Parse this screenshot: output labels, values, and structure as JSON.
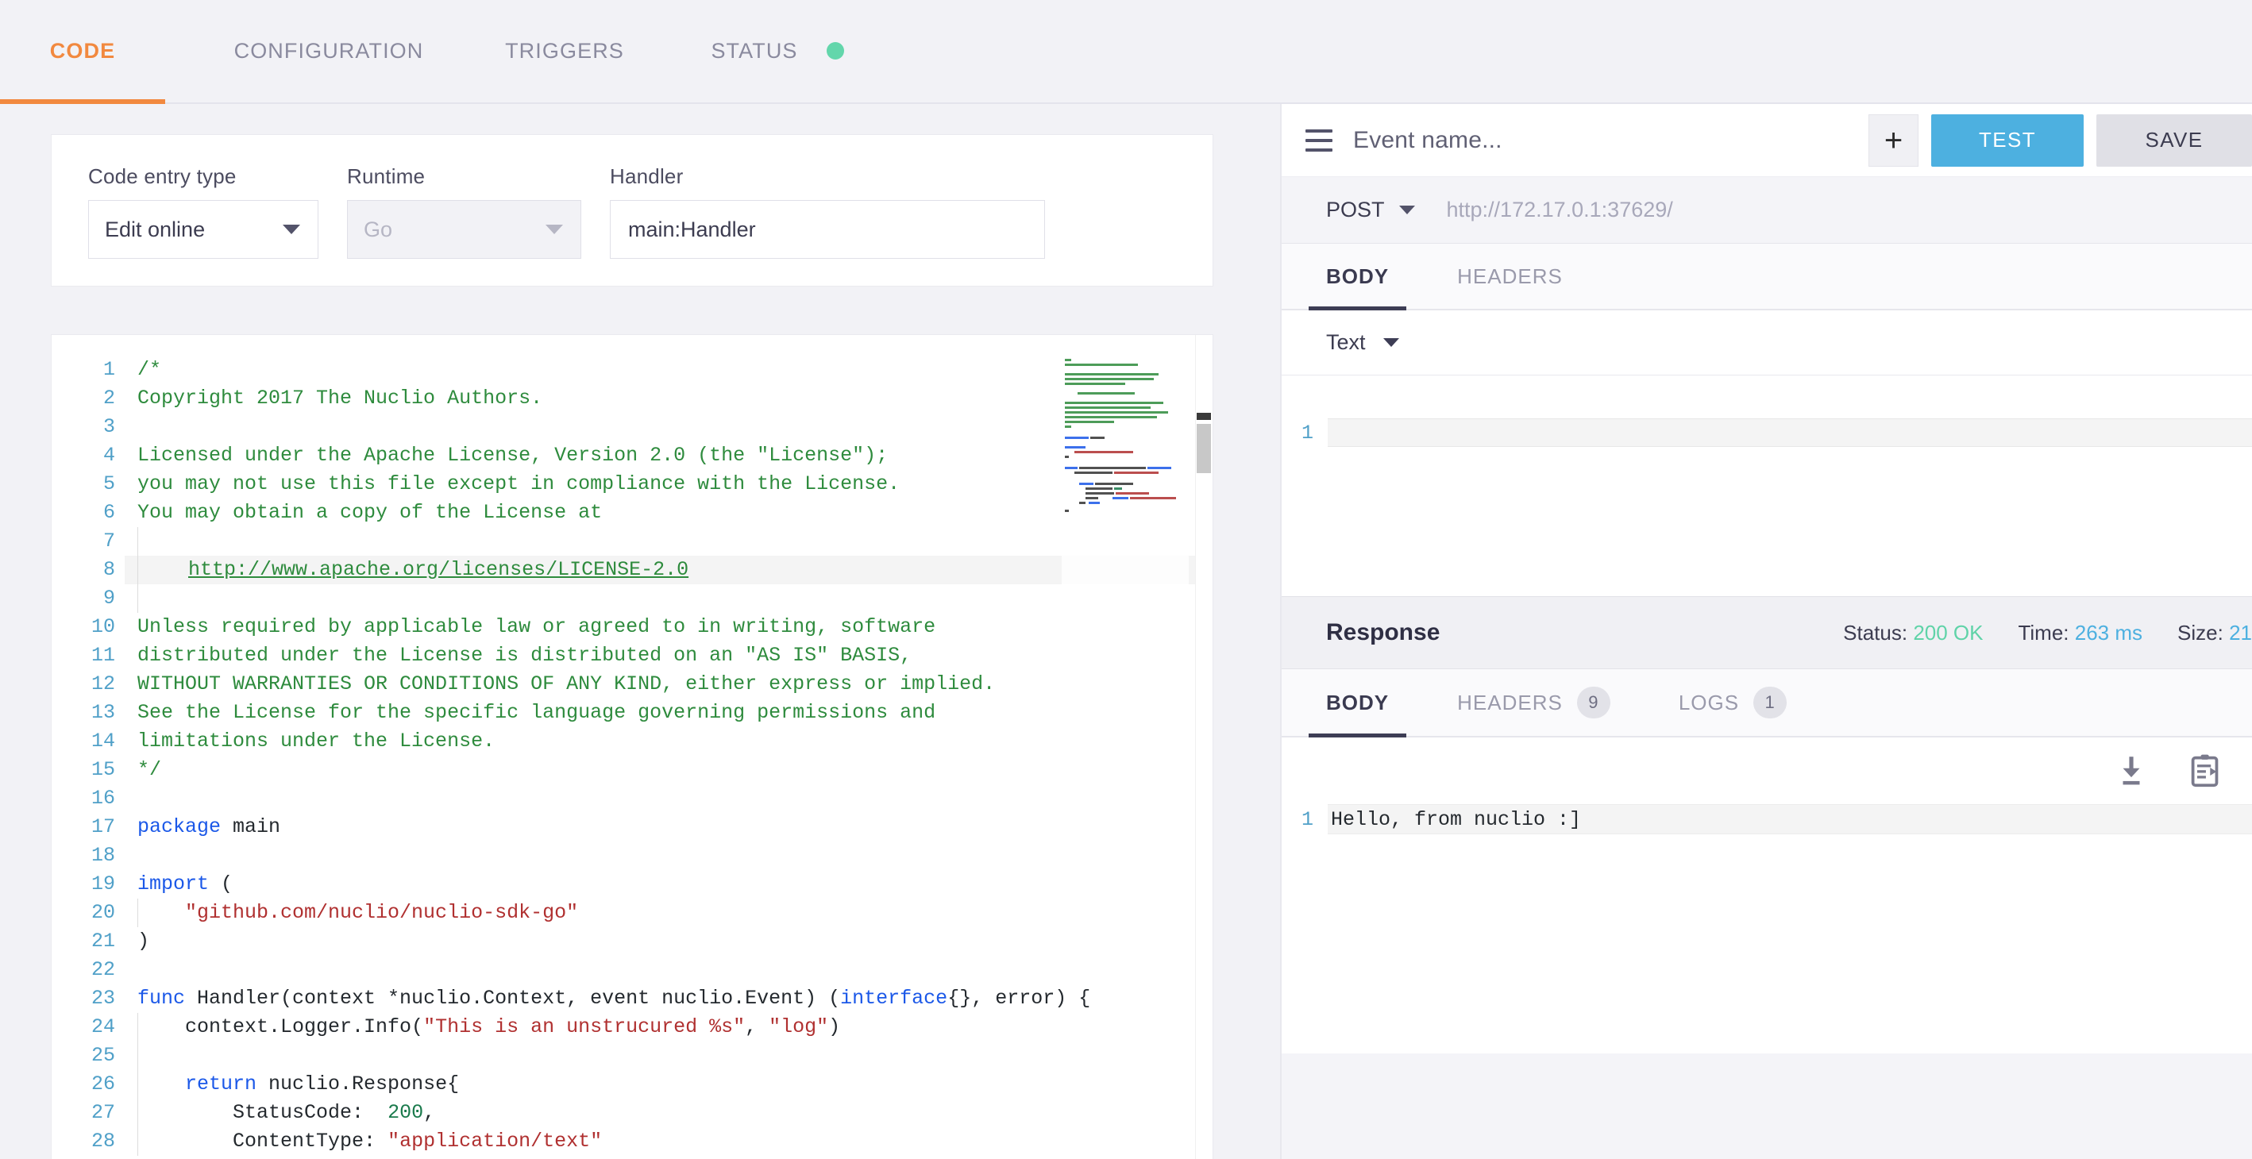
{
  "tabs": [
    {
      "label": "CODE",
      "active": true
    },
    {
      "label": "CONFIGURATION",
      "active": false
    },
    {
      "label": "TRIGGERS",
      "active": false
    },
    {
      "label": "STATUS",
      "active": false
    }
  ],
  "status_indicator": {
    "name": "status-dot",
    "color": "#63d6ab"
  },
  "form": {
    "code_entry_type": {
      "label": "Code entry type",
      "value": "Edit online"
    },
    "runtime": {
      "label": "Runtime",
      "value": "Go",
      "disabled": true
    },
    "handler": {
      "label": "Handler",
      "value": "main:Handler"
    }
  },
  "editor": {
    "language": "go",
    "line_numbers": [
      1,
      2,
      3,
      4,
      5,
      6,
      7,
      8,
      9,
      10,
      11,
      12,
      13,
      14,
      15,
      16,
      17,
      18,
      19,
      20,
      21,
      22,
      23,
      24,
      25,
      26,
      27,
      28
    ],
    "lines": [
      "/*",
      "Copyright 2017 The Nuclio Authors.",
      "",
      "Licensed under the Apache License, Version 2.0 (the \"License\");",
      "you may not use this file except in compliance with the License.",
      "You may obtain a copy of the License at",
      "",
      "    http://www.apache.org/licenses/LICENSE-2.0",
      "",
      "Unless required by applicable law or agreed to in writing, software",
      "distributed under the License is distributed on an \"AS IS\" BASIS,",
      "WITHOUT WARRANTIES OR CONDITIONS OF ANY KIND, either express or implied.",
      "See the License for the specific language governing permissions and",
      "limitations under the License.",
      "*/",
      "",
      "package main",
      "",
      "import (",
      "    \"github.com/nuclio/nuclio-sdk-go\"",
      ")",
      "",
      "func Handler(context *nuclio.Context, event nuclio.Event) (interface{}, error) {",
      "    context.Logger.Info(\"This is an unstrucured %s\", \"log\")",
      "",
      "    return nuclio.Response{",
      "        StatusCode:  200,",
      "        ContentType: \"application/text\""
    ],
    "highlighted_line": 8,
    "link_line_text": "http://www.apache.org/licenses/LICENSE-2.0"
  },
  "request": {
    "event_name_placeholder": "Event name...",
    "menu_icon": "hamburger-icon",
    "add_label": "+",
    "test_label": "TEST",
    "save_label": "SAVE",
    "method": "POST",
    "url": "http://172.17.0.1:37629/",
    "tabs": [
      {
        "label": "BODY",
        "active": true
      },
      {
        "label": "HEADERS",
        "active": false
      }
    ],
    "format": "Text",
    "body_line_number": "1",
    "body_value": ""
  },
  "response": {
    "title": "Response",
    "status_label": "Status:",
    "status_value": "200 OK",
    "time_label": "Time:",
    "time_value": "263 ms",
    "size_label": "Size:",
    "size_value": "21",
    "tabs": [
      {
        "label": "BODY",
        "active": true,
        "badge": ""
      },
      {
        "label": "HEADERS",
        "active": false,
        "badge": "9"
      },
      {
        "label": "LOGS",
        "active": false,
        "badge": "1"
      }
    ],
    "download_icon": "download-icon",
    "copy_icon": "copy-to-clipboard-icon",
    "body_line_number": "1",
    "body_value": "Hello, from nuclio :]"
  },
  "colors": {
    "accent_orange": "#f2893f",
    "test_blue": "#4db0e0",
    "status_green": "#5fd3a8",
    "time_blue": "#4db0e0"
  }
}
